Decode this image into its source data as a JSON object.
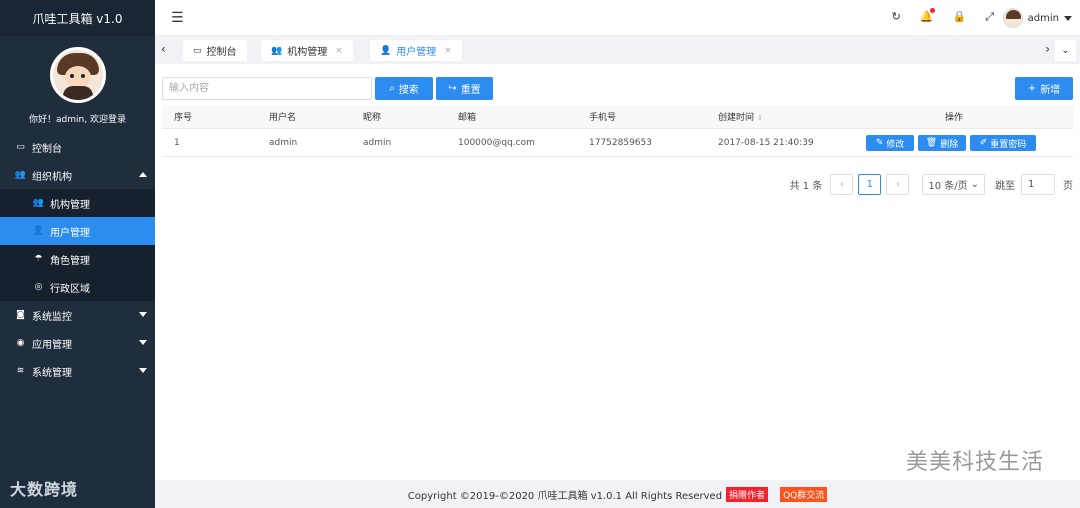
{
  "app": {
    "title": "爪哇工具箱 v1.0",
    "welcome": "你好！admin, 欢迎登录",
    "bottom_logo": "大数跨境"
  },
  "sidebar": {
    "items": [
      {
        "label": "控制台",
        "icon": "monitor-icon"
      },
      {
        "label": "组织机构",
        "icon": "users-icon",
        "expanded": true,
        "children": [
          {
            "label": "机构管理",
            "icon": "group-icon"
          },
          {
            "label": "用户管理",
            "icon": "user-icon",
            "active": true
          },
          {
            "label": "角色管理",
            "icon": "umbrella-icon"
          },
          {
            "label": "行政区域",
            "icon": "compass-icon"
          }
        ]
      },
      {
        "label": "系统监控",
        "icon": "camera-icon"
      },
      {
        "label": "应用管理",
        "icon": "gauge-icon"
      },
      {
        "label": "系统管理",
        "icon": "layers-icon"
      }
    ]
  },
  "header": {
    "username": "admin"
  },
  "tabs": [
    {
      "label": "控制台",
      "icon": "monitor-icon"
    },
    {
      "label": "机构管理",
      "icon": "group-icon",
      "close": "×"
    },
    {
      "label": "用户管理",
      "icon": "user-icon",
      "close": "×",
      "active": true
    }
  ],
  "search": {
    "placeholder": "输入内容",
    "search_label": "搜索",
    "reset_label": "重置",
    "add_label": "新增"
  },
  "table": {
    "headers": [
      "序号",
      "用户名",
      "昵称",
      "邮箱",
      "手机号",
      "创建时间",
      "操作"
    ],
    "rows": [
      {
        "index": "1",
        "username": "admin",
        "nickname": "admin",
        "email": "100000@qq.com",
        "phone": "17752859653",
        "created": "2017-08-15 21:40:39"
      }
    ],
    "actions": {
      "edit": "修改",
      "delete": "删除",
      "reset_password": "重置密码"
    }
  },
  "pager": {
    "total": "共 1 条",
    "current_page": "1",
    "page_size": "10 条/页",
    "goto_label": "跳至",
    "goto_value": "1",
    "page_suffix": "页"
  },
  "footer": {
    "copyright": "Copyright ©2019-©2020 爪哇工具箱 v1.0.1 All Rights Reserved",
    "donate": "捐赠作者",
    "qq": "QQ群交流"
  },
  "watermark": "美美科技生活",
  "colors": {
    "sidebar_bg": "#1f2d3d",
    "primary": "#2d8cf0",
    "badge_red": "#f5222d",
    "badge_orange": "#fa541c"
  }
}
